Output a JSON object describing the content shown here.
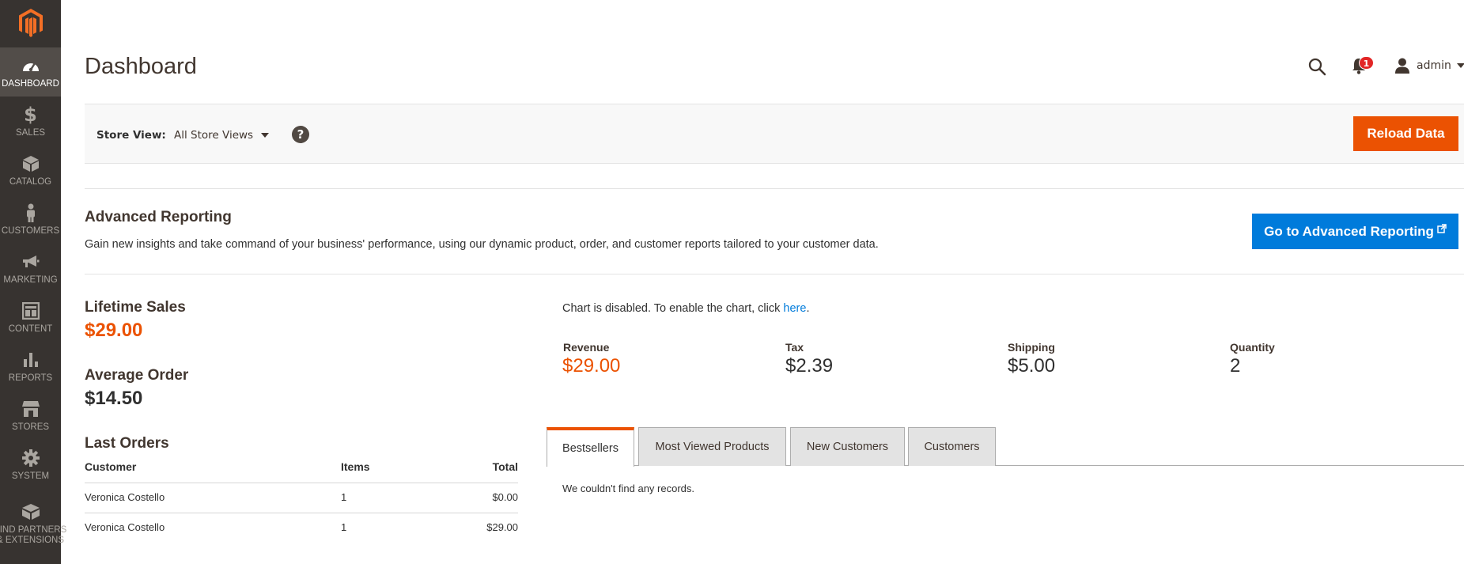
{
  "colors": {
    "accent": "#eb5202",
    "link": "#007bdb",
    "sidebar": "#373330"
  },
  "sidebar": {
    "logo_icon": "magento-logo",
    "items": [
      {
        "label": "DASHBOARD",
        "icon": "dashboard-icon",
        "active": true
      },
      {
        "label": "SALES",
        "icon": "dollar-icon"
      },
      {
        "label": "CATALOG",
        "icon": "cube-icon"
      },
      {
        "label": "CUSTOMERS",
        "icon": "person-icon"
      },
      {
        "label": "MARKETING",
        "icon": "megaphone-icon"
      },
      {
        "label": "CONTENT",
        "icon": "layout-icon"
      },
      {
        "label": "REPORTS",
        "icon": "bar-chart-icon"
      },
      {
        "label": "STORES",
        "icon": "store-icon"
      },
      {
        "label": "SYSTEM",
        "icon": "gear-icon"
      },
      {
        "label": "FIND PARTNERS",
        "label2": "& EXTENSIONS",
        "icon": "box-icon"
      }
    ]
  },
  "header": {
    "title": "Dashboard",
    "notifications_count": "1",
    "user_name": "admin"
  },
  "store_bar": {
    "label": "Store View:",
    "value": "All Store Views",
    "help": "?",
    "reload_label": "Reload Data"
  },
  "advanced_reporting": {
    "title": "Advanced Reporting",
    "description": "Gain new insights and take command of your business' performance, using our dynamic product, order, and customer reports tailored to your customer data.",
    "button_label": "Go to Advanced Reporting"
  },
  "stats": {
    "lifetime_sales_label": "Lifetime Sales",
    "lifetime_sales_value": "$29.00",
    "average_order_label": "Average Order",
    "average_order_value": "$14.50",
    "last_orders_label": "Last Orders"
  },
  "last_orders": {
    "columns": [
      "Customer",
      "Items",
      "Total"
    ],
    "rows": [
      [
        "Veronica Costello",
        "1",
        "$0.00"
      ],
      [
        "Veronica Costello",
        "1",
        "$29.00"
      ]
    ]
  },
  "chart": {
    "message": "Chart is disabled. To enable the chart, click ",
    "link": "here",
    "end": "."
  },
  "totals": [
    {
      "label": "Revenue",
      "value": "$29.00"
    },
    {
      "label": "Tax",
      "value": "$2.39"
    },
    {
      "label": "Shipping",
      "value": "$5.00"
    },
    {
      "label": "Quantity",
      "value": "2"
    }
  ],
  "tabs": [
    {
      "label": "Bestsellers",
      "active": true
    },
    {
      "label": "Most Viewed Products"
    },
    {
      "label": "New Customers"
    },
    {
      "label": "Customers"
    }
  ],
  "tab_content": {
    "empty_message": "We couldn't find any records."
  }
}
